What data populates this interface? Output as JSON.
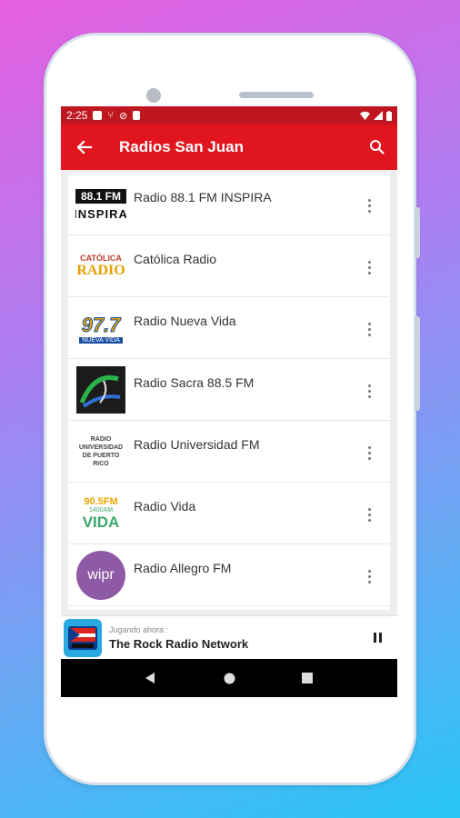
{
  "statusbar": {
    "time": "2:25"
  },
  "appbar": {
    "title": "Radios San Juan"
  },
  "stations": [
    {
      "name": "Radio 88.1 FM INSPIRA",
      "logo": "inspira-logo",
      "logo_text": "88.1 FM"
    },
    {
      "name": "Católica Radio",
      "logo": "catolica-logo",
      "logo_text": "RADIO"
    },
    {
      "name": "Radio Nueva Vida",
      "logo": "nueva-vida-logo",
      "logo_text": "97.7"
    },
    {
      "name": "Radio Sacra 88.5 FM",
      "logo": "sacra-logo",
      "logo_text": ""
    },
    {
      "name": "Radio Universidad FM",
      "logo": "universidad-logo",
      "logo_text": "RADIO UNIVERSIDAD DE PUERTO RICO"
    },
    {
      "name": "Radio Vida",
      "logo": "vida-logo",
      "logo_text": "VIDA"
    },
    {
      "name": "Radio Allegro FM",
      "logo": "wipr-logo",
      "logo_text": "wipr"
    }
  ],
  "player": {
    "subtitle": "Jugando ahora :",
    "now_playing": "The Rock Radio Network"
  },
  "colors": {
    "statusbar": "#c0161f",
    "appbar": "#e1151e"
  }
}
